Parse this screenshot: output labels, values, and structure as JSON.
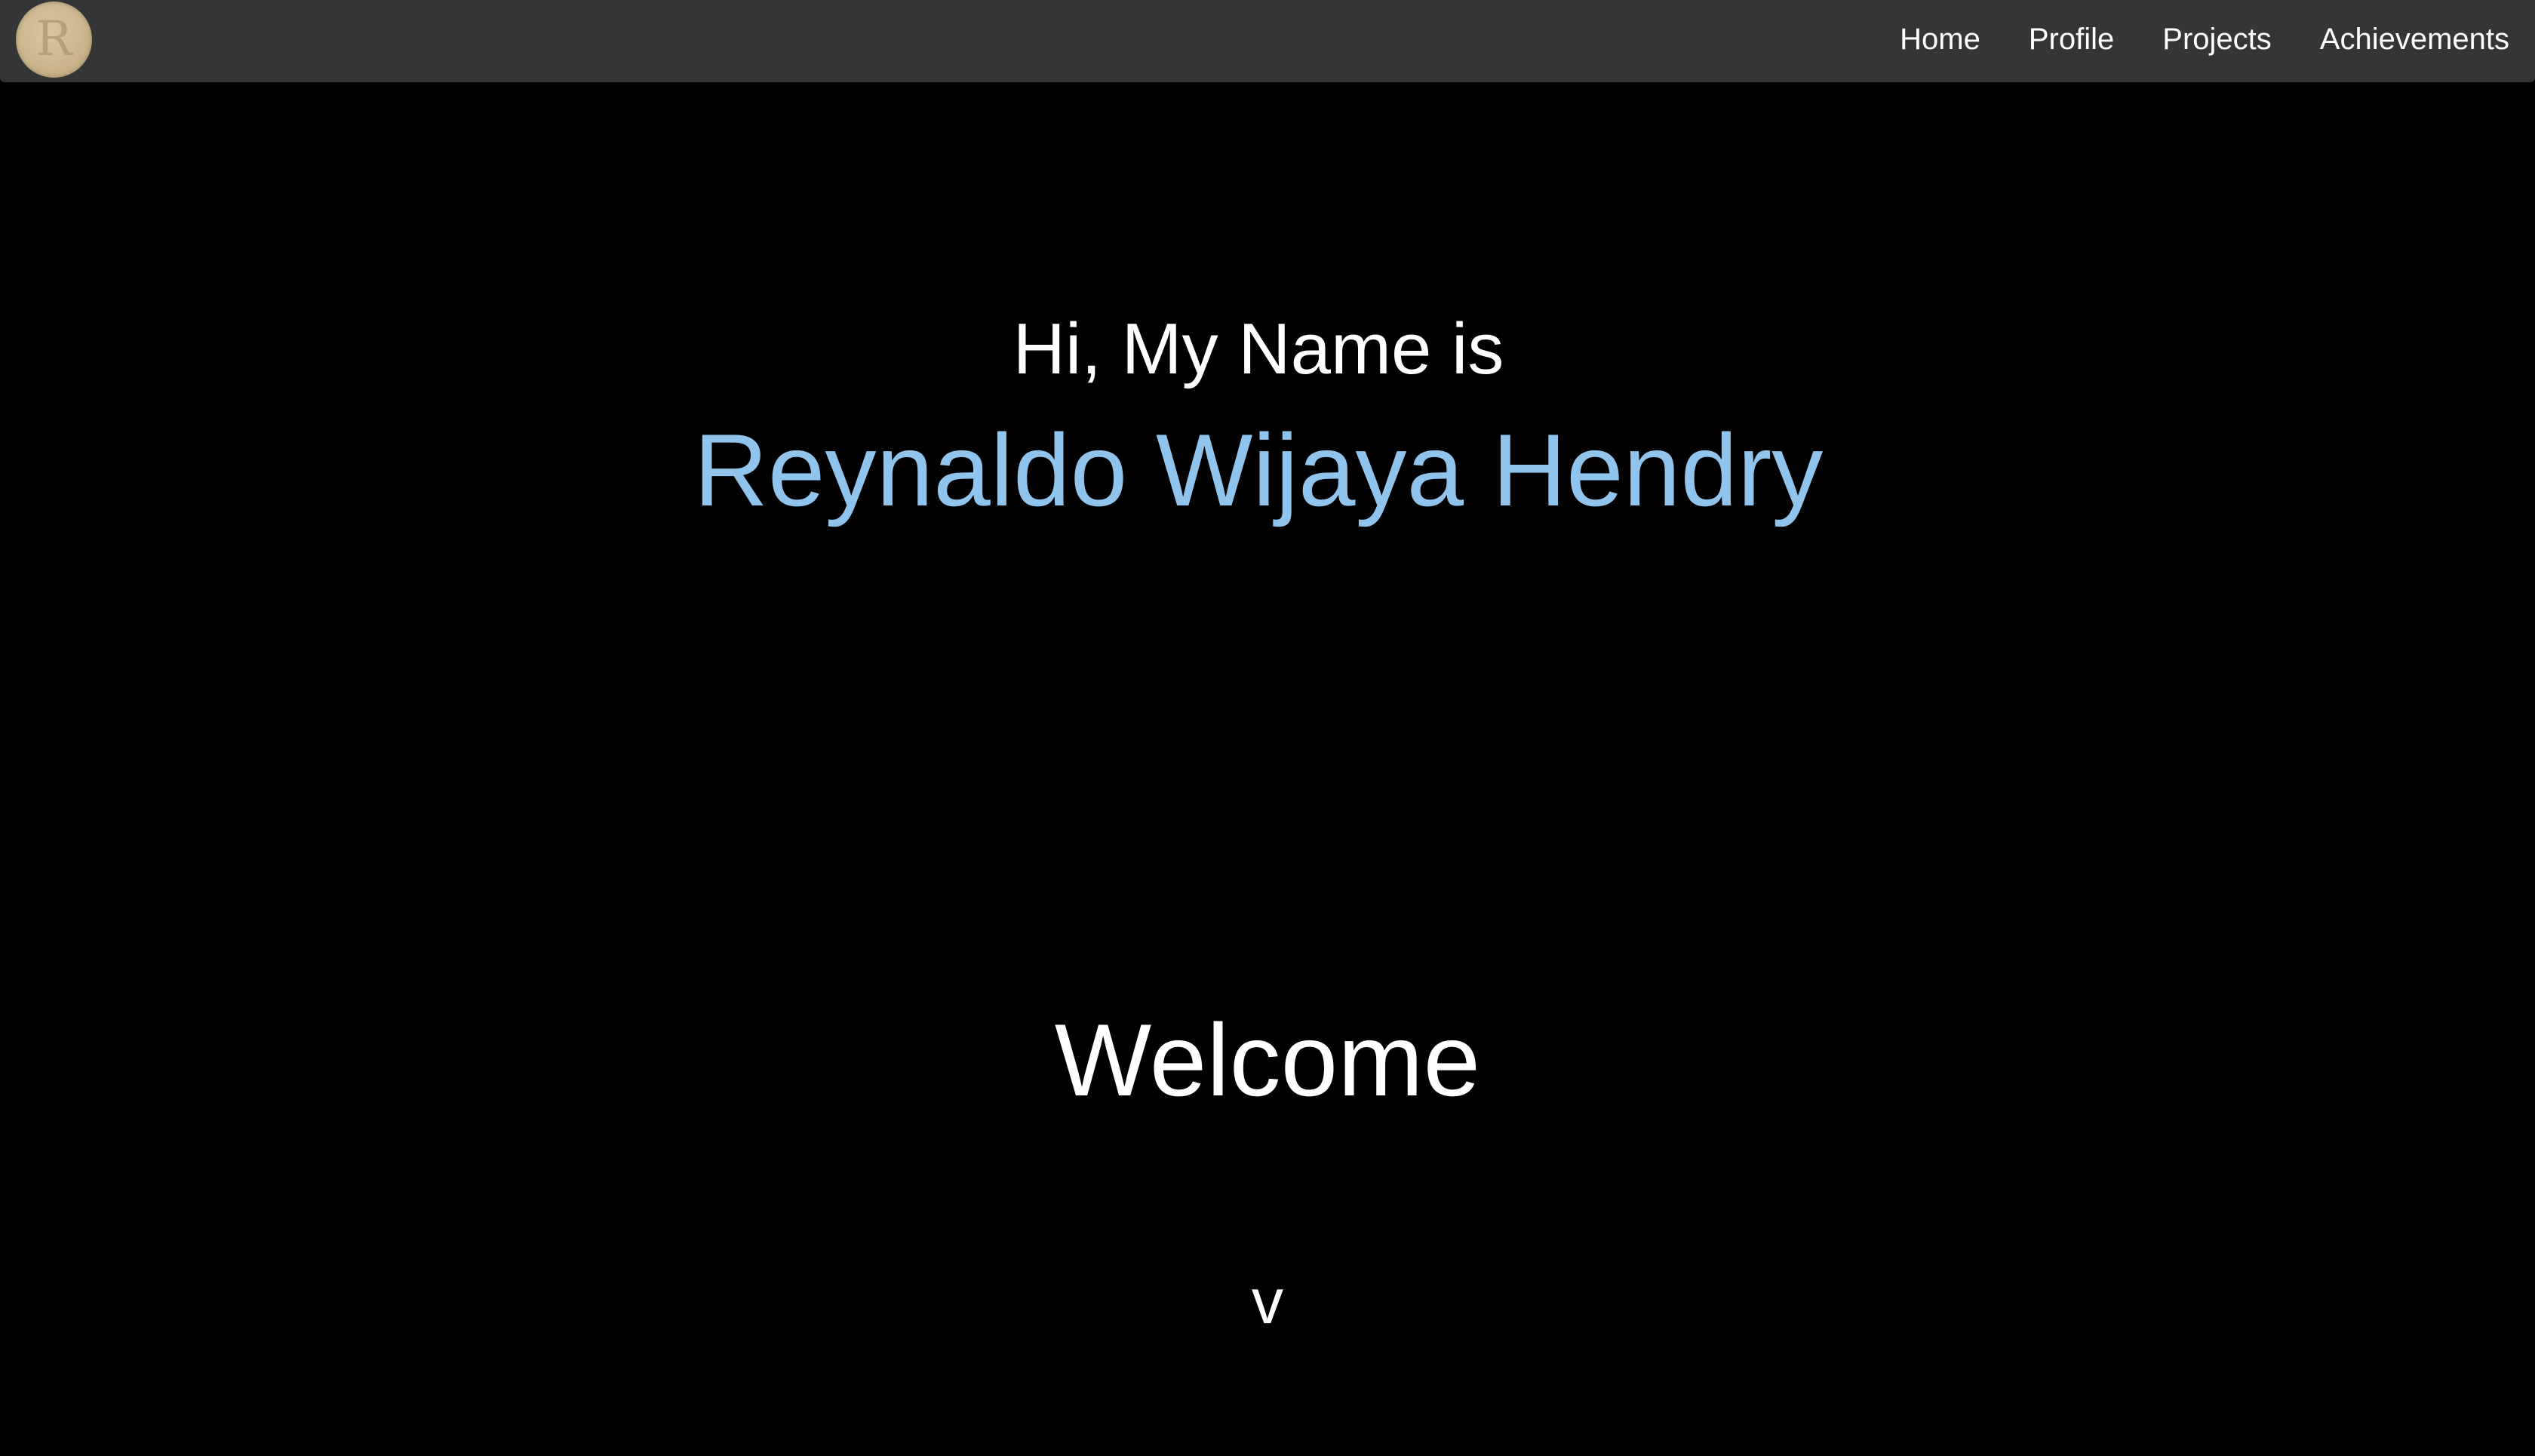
{
  "navbar": {
    "logo_letter": "R",
    "items": [
      {
        "label": "Home"
      },
      {
        "label": "Profile"
      },
      {
        "label": "Projects"
      },
      {
        "label": "Achievements"
      }
    ]
  },
  "hero": {
    "greeting": "Hi, My Name is",
    "name": "Reynaldo Wijaya Hendry",
    "welcome": "Welcome",
    "scroll_indicator": "v"
  },
  "colors": {
    "background": "#000000",
    "navbar": "#353535",
    "accent_name": "#90c4ec",
    "text": "#ffffff"
  }
}
